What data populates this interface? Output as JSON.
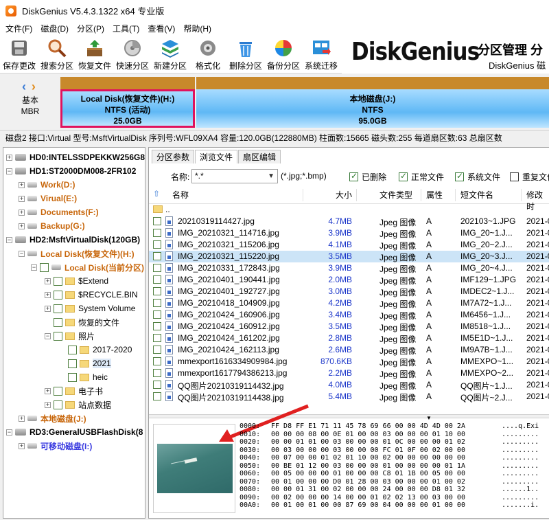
{
  "app": {
    "title": "DiskGenius V5.4.3.1322 x64 专业版"
  },
  "menu": [
    "文件(F)",
    "磁盘(D)",
    "分区(P)",
    "工具(T)",
    "查看(V)",
    "帮助(H)"
  ],
  "toolbar": {
    "buttons": [
      {
        "label": "保存更改",
        "icon": "save-disk-icon"
      },
      {
        "label": "搜索分区",
        "icon": "magnifier-icon"
      },
      {
        "label": "恢复文件",
        "icon": "recover-box-icon"
      },
      {
        "label": "快速分区",
        "icon": "quick-partition-icon"
      },
      {
        "label": "新建分区",
        "icon": "new-partition-icon"
      },
      {
        "label": "格式化",
        "icon": "format-gear-icon"
      },
      {
        "label": "删除分区",
        "icon": "trash-icon"
      },
      {
        "label": "备份分区",
        "icon": "backup-pie-icon"
      },
      {
        "label": "系统迁移",
        "icon": "migrate-window-icon"
      }
    ],
    "banner": {
      "logo": "DiskGenius",
      "slogan": "分区管理 分",
      "sub": "DiskGenius 磁"
    }
  },
  "diskmap": {
    "nav_left": "‹",
    "nav_right": "›",
    "basic_line1": "基本",
    "basic_line2": "MBR",
    "partitions": [
      {
        "name": "Local Disk(恢复文件)(H:)",
        "fs": "NTFS (活动)",
        "size": "25.0GB"
      },
      {
        "name": "本地磁盘(J:)",
        "fs": "NTFS",
        "size": "95.0GB"
      }
    ]
  },
  "diskinfo": "磁盘2 接口:Virtual  型号:MsftVirtualDisk  序列号:WFL09XA4  容量:120.0GB(122880MB)  柱面数:15665  磁头数:255  每道扇区数:63  总扇区数",
  "tree": [
    {
      "label": "HD0:INTELSSDPEKKW256G8",
      "type": "disk",
      "indent": 0
    },
    {
      "label": "HD1:ST2000DM008-2FR102",
      "type": "disk",
      "indent": 0
    },
    {
      "label": "Work(D:)",
      "type": "part",
      "indent": 1,
      "style": "orange"
    },
    {
      "label": "Virual(E:)",
      "type": "part",
      "indent": 1,
      "style": "orange"
    },
    {
      "label": "Documents(F:)",
      "type": "part",
      "indent": 1,
      "style": "orange"
    },
    {
      "label": "Backup(G:)",
      "type": "part",
      "indent": 1,
      "style": "orange"
    },
    {
      "label": "HD2:MsftVirtualDisk(120GB)",
      "type": "disk",
      "indent": 0
    },
    {
      "label": "Local Disk(恢复文件)(H:)",
      "type": "part",
      "indent": 1,
      "style": "orange"
    },
    {
      "label": "Local Disk(当前分区)",
      "type": "part",
      "indent": 2,
      "style": "orange"
    },
    {
      "label": "$Extend",
      "type": "folder",
      "indent": 3
    },
    {
      "label": "$RECYCLE.BIN",
      "type": "folder",
      "indent": 3
    },
    {
      "label": "System Volume",
      "type": "folder",
      "indent": 3
    },
    {
      "label": "恢复的文件",
      "type": "folder",
      "indent": 3
    },
    {
      "label": "照片",
      "type": "folder",
      "indent": 3
    },
    {
      "label": "2017-2020",
      "type": "folder",
      "indent": 4
    },
    {
      "label": "2021",
      "type": "folder",
      "indent": 4,
      "selected": true
    },
    {
      "label": "heic",
      "type": "folder",
      "indent": 4
    },
    {
      "label": "电子书",
      "type": "folder",
      "indent": 3
    },
    {
      "label": "站点数据",
      "type": "folder",
      "indent": 3
    },
    {
      "label": "本地磁盘(J:)",
      "type": "part",
      "indent": 1,
      "style": "orange"
    },
    {
      "label": "RD3:GeneralUSBFlashDisk(8",
      "type": "disk",
      "indent": 0
    },
    {
      "label": "可移动磁盘(I:)",
      "type": "part",
      "indent": 1,
      "style": "blue"
    }
  ],
  "tabs": [
    "分区参数",
    "浏览文件",
    "扇区编辑"
  ],
  "filter": {
    "name_label": "名称:",
    "name_value": "*.*",
    "hint": "(*.jpg;*.bmp)",
    "checks": [
      {
        "label": "已删除",
        "checked": true
      },
      {
        "label": "正常文件",
        "checked": true
      },
      {
        "label": "系统文件",
        "checked": true
      },
      {
        "label": "重复文件",
        "checked": false
      }
    ]
  },
  "columns": [
    "名称",
    "大小",
    "文件类型",
    "属性",
    "短文件名",
    "修改时"
  ],
  "parent_row": "..",
  "files": [
    {
      "name": "20210319114427.jpg",
      "size": "4.7MB",
      "type": "Jpeg 图像",
      "attr": "A",
      "short": "202103~1.JPG",
      "mod": "2021-0"
    },
    {
      "name": "IMG_20210321_114716.jpg",
      "size": "3.9MB",
      "type": "Jpeg 图像",
      "attr": "A",
      "short": "IMG_20~1.J...",
      "mod": "2021-0"
    },
    {
      "name": "IMG_20210321_115206.jpg",
      "size": "4.1MB",
      "type": "Jpeg 图像",
      "attr": "A",
      "short": "IMG_20~2.J...",
      "mod": "2021-0"
    },
    {
      "name": "IMG_20210321_115220.jpg",
      "size": "3.5MB",
      "type": "Jpeg 图像",
      "attr": "A",
      "short": "IMG_20~3.J...",
      "mod": "2021-0",
      "selected": true
    },
    {
      "name": "IMG_20210331_172843.jpg",
      "size": "3.9MB",
      "type": "Jpeg 图像",
      "attr": "A",
      "short": "IMG_20~4.J...",
      "mod": "2021-0"
    },
    {
      "name": "IMG_20210401_190441.jpg",
      "size": "2.0MB",
      "type": "Jpeg 图像",
      "attr": "A",
      "short": "IMF129~1.JPG",
      "mod": "2021-0"
    },
    {
      "name": "IMG_20210401_192727.jpg",
      "size": "3.0MB",
      "type": "Jpeg 图像",
      "attr": "A",
      "short": "IMDEC2~1.J...",
      "mod": "2021-0"
    },
    {
      "name": "IMG_20210418_104909.jpg",
      "size": "4.2MB",
      "type": "Jpeg 图像",
      "attr": "A",
      "short": "IM7A72~1.J...",
      "mod": "2021-0"
    },
    {
      "name": "IMG_20210424_160906.jpg",
      "size": "3.4MB",
      "type": "Jpeg 图像",
      "attr": "A",
      "short": "IM6456~1.J...",
      "mod": "2021-0"
    },
    {
      "name": "IMG_20210424_160912.jpg",
      "size": "3.5MB",
      "type": "Jpeg 图像",
      "attr": "A",
      "short": "IM8518~1.J...",
      "mod": "2021-0"
    },
    {
      "name": "IMG_20210424_161202.jpg",
      "size": "2.8MB",
      "type": "Jpeg 图像",
      "attr": "A",
      "short": "IM5E1D~1.J...",
      "mod": "2021-0"
    },
    {
      "name": "IMG_20210424_162113.jpg",
      "size": "2.6MB",
      "type": "Jpeg 图像",
      "attr": "A",
      "short": "IM9A7B~1.J...",
      "mod": "2021-0"
    },
    {
      "name": "mmexport1616334909984.jpg",
      "size": "870.6KB",
      "type": "Jpeg 图像",
      "attr": "A",
      "short": "MMEXPO~1...",
      "mod": "2021-0"
    },
    {
      "name": "mmexport1617794386213.jpg",
      "size": "2.2MB",
      "type": "Jpeg 图像",
      "attr": "A",
      "short": "MMEXPO~2...",
      "mod": "2021-0"
    },
    {
      "name": "QQ图片20210319114432.jpg",
      "size": "4.0MB",
      "type": "Jpeg 图像",
      "attr": "A",
      "short": "QQ图片~1.J...",
      "mod": "2021-0"
    },
    {
      "name": "QQ图片20210319114438.jpg",
      "size": "5.4MB",
      "type": "Jpeg 图像",
      "attr": "A",
      "short": "QQ图片~2.J...",
      "mod": "2021-0"
    }
  ],
  "hex": [
    {
      "off": "0000:",
      "bytes": "FF D8 FF E1 71 11 45 78 69 66 00 00 4D 4D 00 2A",
      "asc": "....q.Exi"
    },
    {
      "off": "0010:",
      "bytes": "00 00 00 08 00 0E 01 00 00 03 00 00 00 01 10 00",
      "asc": "........."
    },
    {
      "off": "0020:",
      "bytes": "00 00 01 01 00 03 00 00 00 01 0C 00 00 00 01 02",
      "asc": "........."
    },
    {
      "off": "0030:",
      "bytes": "00 03 00 00 00 03 00 00 00 FC 01 0F 00 02 00 00",
      "asc": "........."
    },
    {
      "off": "0040:",
      "bytes": "00 07 00 00 01 02 01 10 00 02 00 00 00 00 00 00",
      "asc": "........."
    },
    {
      "off": "0050:",
      "bytes": "00 BE 01 12 00 03 00 00 00 01 00 00 00 00 01 1A",
      "asc": "........."
    },
    {
      "off": "0060:",
      "bytes": "00 05 00 00 00 01 00 00 00 C8 01 1B 00 05 00 00",
      "asc": "........."
    },
    {
      "off": "0070:",
      "bytes": "00 01 00 00 00 D0 01 28 00 03 00 00 00 01 00 02",
      "asc": "........."
    },
    {
      "off": "0080:",
      "bytes": "00 00 01 31 00 02 00 00 00 24 00 00 00 D8 01 32",
      "asc": "......1.."
    },
    {
      "off": "0090:",
      "bytes": "00 02 00 00 00 14 00 00 01 02 02 13 00 03 00 00",
      "asc": "........."
    },
    {
      "off": "00A0:",
      "bytes": "00 01 00 01 00 00 87 69 00 04 00 00 00 01 00 00",
      "asc": ".......i."
    }
  ]
}
